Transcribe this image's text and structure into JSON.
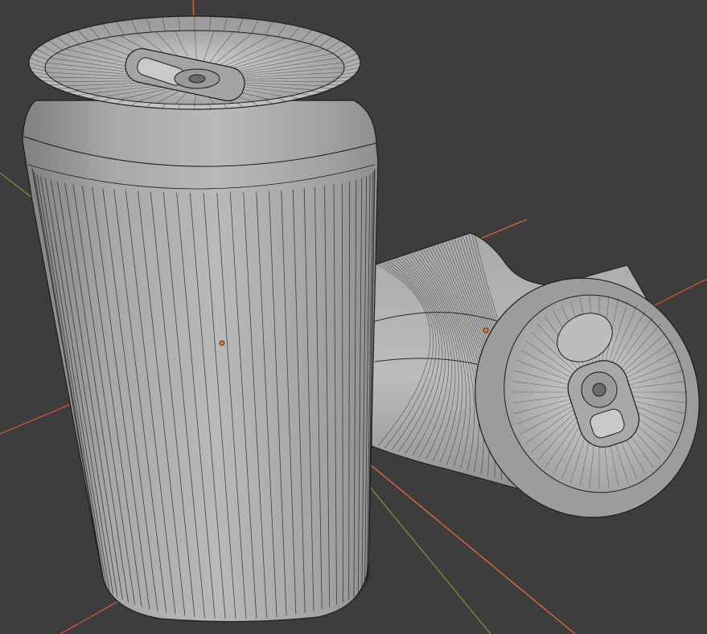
{
  "viewport": {
    "background": "#3d3d3d",
    "shading": "solid",
    "overlay": "wireframe",
    "selected_objects": 0
  },
  "axes": {
    "x_axis_color": "#c8543a",
    "y_axis_color": "#6b8f3a",
    "z_axis_color": "#c8543a"
  },
  "objects": [
    {
      "name": "upright-can",
      "type": "mesh",
      "has_origin_marker": true
    },
    {
      "name": "crushed-can",
      "type": "mesh",
      "has_origin_marker": true
    }
  ],
  "colors": {
    "mesh_fill": "#b4b4b4",
    "mesh_dark": "#7c7c7c",
    "wire": "#1c1c1c",
    "origin_marker": "#e07a2e"
  }
}
